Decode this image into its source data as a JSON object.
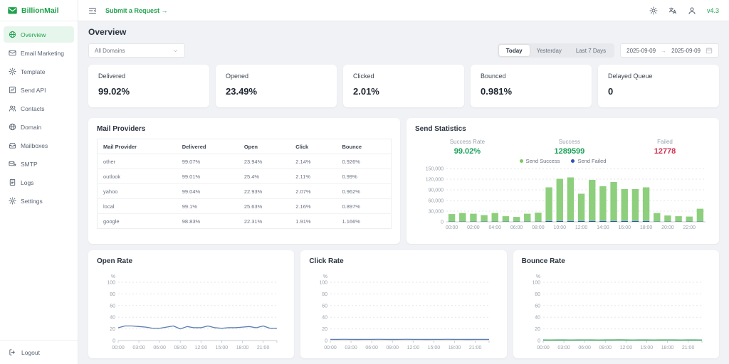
{
  "app": {
    "name": "BillionMail",
    "version": "v4.3"
  },
  "topbar": {
    "menu_toggle_icon": "menu-fold-icon",
    "submit_request_label": "Submit a Request →",
    "theme_icon": "sun-icon",
    "language_icon": "translate-icon",
    "account_icon": "user-icon"
  },
  "header": {
    "title": "Overview"
  },
  "sidebar": {
    "items": [
      {
        "label": "Overview",
        "icon": "globe-icon",
        "active": true
      },
      {
        "label": "Email Marketing",
        "icon": "email-campaign-icon",
        "active": false
      },
      {
        "label": "Template",
        "icon": "gear-icon",
        "active": false
      },
      {
        "label": "Send API",
        "icon": "chart-line-icon",
        "active": false
      },
      {
        "label": "Contacts",
        "icon": "contacts-icon",
        "active": false
      },
      {
        "label": "Domain",
        "icon": "domain-globe-icon",
        "active": false
      },
      {
        "label": "Mailboxes",
        "icon": "mailbox-icon",
        "active": false
      },
      {
        "label": "SMTP",
        "icon": "smtp-send-icon",
        "active": false
      },
      {
        "label": "Logs",
        "icon": "logs-icon",
        "active": false
      },
      {
        "label": "Settings",
        "icon": "settings-gear-icon",
        "active": false
      }
    ],
    "logout_label": "Logout",
    "logout_icon": "logout-icon"
  },
  "filters": {
    "domain_select": "All Domains",
    "range_buttons": [
      {
        "label": "Today",
        "active": true
      },
      {
        "label": "Yesterday",
        "active": false
      },
      {
        "label": "Last 7 Days",
        "active": false
      }
    ],
    "date_start": "2025-09-09",
    "date_separator": "→",
    "date_end": "2025-09-09",
    "calendar_icon": "calendar-icon"
  },
  "stat_cards": [
    {
      "label": "Delivered",
      "value": "99.02%"
    },
    {
      "label": "Opened",
      "value": "23.49%"
    },
    {
      "label": "Clicked",
      "value": "2.01%"
    },
    {
      "label": "Bounced",
      "value": "0.981%"
    },
    {
      "label": "Delayed Queue",
      "value": "0"
    }
  ],
  "mail_providers": {
    "title": "Mail Providers",
    "columns": [
      "Mail Provider",
      "Delivered",
      "Open",
      "Click",
      "Bounce"
    ],
    "rows": [
      [
        "other",
        "99.07%",
        "23.94%",
        "2.14%",
        "0.926%"
      ],
      [
        "outlook",
        "99.01%",
        "25.4%",
        "2.11%",
        "0.99%"
      ],
      [
        "yahoo",
        "99.04%",
        "22.93%",
        "2.07%",
        "0.962%"
      ],
      [
        "local",
        "99.1%",
        "25.63%",
        "2.16%",
        "0.897%"
      ],
      [
        "google",
        "98.83%",
        "22.31%",
        "1.91%",
        "1.166%"
      ]
    ]
  },
  "send_statistics": {
    "title": "Send Statistics",
    "metrics": [
      {
        "label": "Success Rate",
        "value": "99.02%",
        "color": "#18a058"
      },
      {
        "label": "Success",
        "value": "1289599",
        "color": "#18a058"
      },
      {
        "label": "Failed",
        "value": "12778",
        "color": "#d03050"
      }
    ],
    "legend": [
      {
        "label": "Send Success",
        "color": "#7ec662"
      },
      {
        "label": "Send Failed",
        "color": "#2b50b8"
      }
    ]
  },
  "chart_data": [
    {
      "id": "send_stats",
      "type": "bar",
      "title": "Send Statistics",
      "x": [
        "00:00",
        "01:00",
        "02:00",
        "03:00",
        "04:00",
        "05:00",
        "06:00",
        "07:00",
        "08:00",
        "09:00",
        "10:00",
        "11:00",
        "12:00",
        "13:00",
        "14:00",
        "15:00",
        "16:00",
        "17:00",
        "18:00",
        "19:00",
        "20:00",
        "21:00",
        "22:00",
        "23:00"
      ],
      "xtick_labels_shown": [
        "00:00",
        "02:00",
        "04:00",
        "06:00",
        "08:00",
        "10:00",
        "12:00",
        "14:00",
        "16:00",
        "18:00",
        "20:00",
        "22:00"
      ],
      "series": [
        {
          "name": "Send Failed",
          "color": "#2b50b8",
          "values": [
            60,
            60,
            60,
            50,
            60,
            40,
            40,
            60,
            80,
            1100,
            1500,
            1600,
            900,
            1400,
            1200,
            1300,
            1100,
            1100,
            1200,
            100,
            60,
            50,
            50,
            90
          ]
        },
        {
          "name": "Send Success",
          "color": "#8ecf7d",
          "values": [
            21000,
            24000,
            22000,
            18000,
            24000,
            15000,
            13000,
            22000,
            25000,
            95000,
            119000,
            123000,
            77000,
            116000,
            98000,
            110000,
            90000,
            90000,
            95000,
            24000,
            17000,
            15000,
            14000,
            36000
          ]
        }
      ],
      "stacked": true,
      "ylim": [
        0,
        150000
      ],
      "ytick_labels": [
        "0",
        "30,000",
        "60,000",
        "90,000",
        "120,000",
        "150,000"
      ],
      "grid": true,
      "legend_position": "top"
    },
    {
      "id": "open_rate",
      "type": "line",
      "title": "Open Rate",
      "ylabel": "%",
      "ylim": [
        0,
        100
      ],
      "yticks": [
        0,
        20,
        40,
        60,
        80,
        100
      ],
      "x": [
        "00:00",
        "01:00",
        "02:00",
        "03:00",
        "04:00",
        "05:00",
        "06:00",
        "07:00",
        "08:00",
        "09:00",
        "10:00",
        "11:00",
        "12:00",
        "13:00",
        "14:00",
        "15:00",
        "16:00",
        "17:00",
        "18:00",
        "19:00",
        "20:00",
        "21:00",
        "22:00",
        "23:00"
      ],
      "xtick_labels_shown": [
        "00:00",
        "03:00",
        "06:00",
        "09:00",
        "12:00",
        "15:00",
        "18:00",
        "21:00"
      ],
      "color": "#5b7db1",
      "values": [
        22,
        25,
        25,
        24,
        23,
        21,
        21,
        23,
        25,
        20,
        24,
        22,
        22,
        25,
        22,
        21,
        22,
        22,
        23,
        24,
        22,
        25,
        21,
        21
      ],
      "grid": true
    },
    {
      "id": "click_rate",
      "type": "line",
      "title": "Click Rate",
      "ylabel": "%",
      "ylim": [
        0,
        100
      ],
      "yticks": [
        0,
        20,
        40,
        60,
        80,
        100
      ],
      "x": [
        "00:00",
        "01:00",
        "02:00",
        "03:00",
        "04:00",
        "05:00",
        "06:00",
        "07:00",
        "08:00",
        "09:00",
        "10:00",
        "11:00",
        "12:00",
        "13:00",
        "14:00",
        "15:00",
        "16:00",
        "17:00",
        "18:00",
        "19:00",
        "20:00",
        "21:00",
        "22:00",
        "23:00"
      ],
      "xtick_labels_shown": [
        "00:00",
        "03:00",
        "06:00",
        "09:00",
        "12:00",
        "15:00",
        "18:00",
        "21:00"
      ],
      "color": "#5b7db1",
      "values": [
        2,
        2,
        2.1,
        2,
        1.9,
        2,
        2,
        2.1,
        2,
        1.9,
        2,
        2.1,
        2,
        2,
        1.9,
        2,
        2,
        2.1,
        2,
        2,
        1.9,
        2,
        2,
        2
      ],
      "grid": true
    },
    {
      "id": "bounce_rate",
      "type": "line",
      "title": "Bounce Rate",
      "ylabel": "%",
      "ylim": [
        0,
        100
      ],
      "yticks": [
        0,
        20,
        40,
        60,
        80,
        100
      ],
      "x": [
        "00:00",
        "01:00",
        "02:00",
        "03:00",
        "04:00",
        "05:00",
        "06:00",
        "07:00",
        "08:00",
        "09:00",
        "10:00",
        "11:00",
        "12:00",
        "13:00",
        "14:00",
        "15:00",
        "16:00",
        "17:00",
        "18:00",
        "19:00",
        "20:00",
        "21:00",
        "22:00",
        "23:00"
      ],
      "xtick_labels_shown": [
        "00:00",
        "03:00",
        "06:00",
        "09:00",
        "12:00",
        "15:00",
        "18:00",
        "21:00"
      ],
      "color": "#2f9e4f",
      "values": [
        1,
        0.9,
        1,
        1,
        0.9,
        1,
        1.1,
        1,
        0.9,
        1,
        1,
        1.2,
        1,
        0.9,
        1,
        1,
        0.9,
        1,
        1.1,
        1,
        0.9,
        1,
        1,
        0.9
      ],
      "grid": true
    }
  ]
}
